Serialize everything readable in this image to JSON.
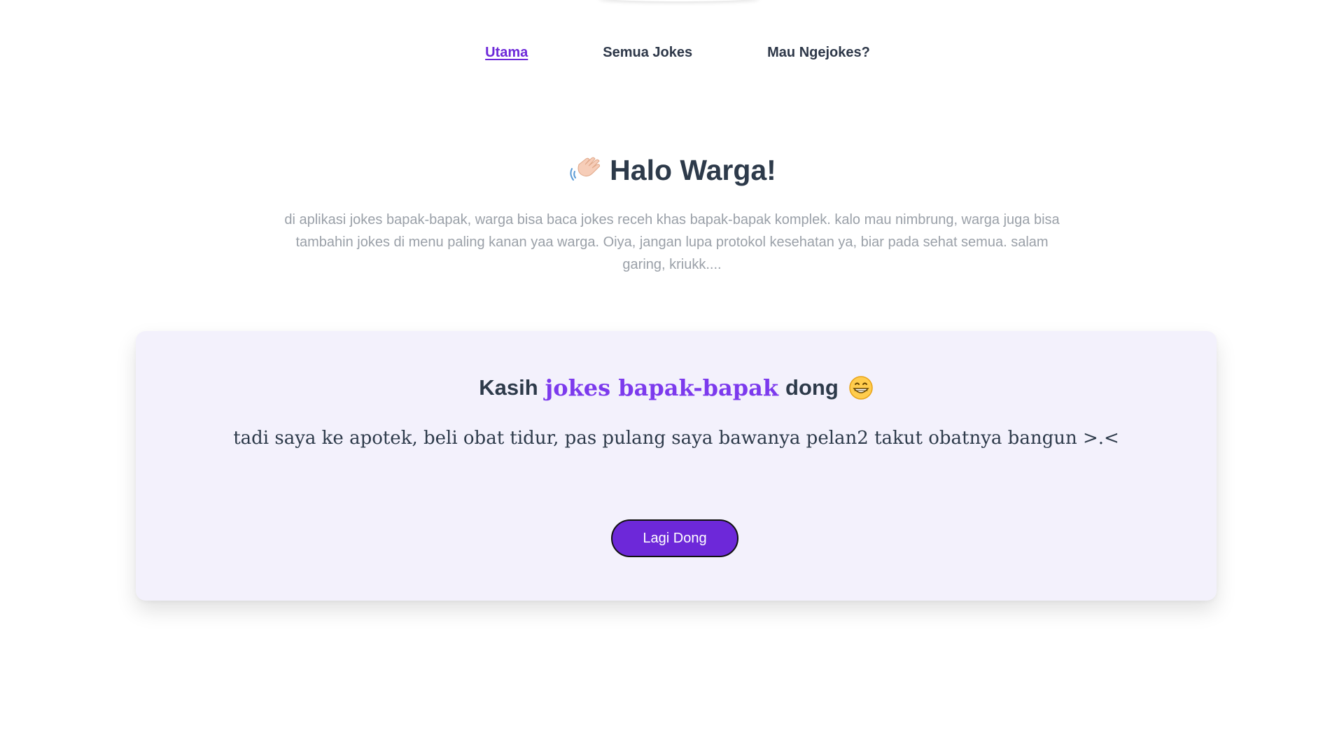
{
  "nav": {
    "items": [
      {
        "label": "Utama",
        "active": true
      },
      {
        "label": "Semua Jokes",
        "active": false
      },
      {
        "label": "Mau Ngejokes?",
        "active": false
      }
    ]
  },
  "hero": {
    "icon": "waving-hand-icon",
    "title": "Halo Warga!",
    "description": "di aplikasi jokes bapak-bapak, warga bisa baca jokes receh khas bapak-bapak komplek. kalo mau nimbrung, warga juga bisa tambahin jokes di menu paling kanan yaa warga. Oiya, jangan lupa protokol kesehatan ya, biar pada sehat semua. salam garing, kriukk...."
  },
  "card": {
    "title_prefix": "Kasih",
    "title_highlight": "jokes bapak-bapak",
    "title_suffix": "dong",
    "title_icon": "grinning-face-icon",
    "joke": "tadi saya ke apotek, beli obat tidur, pas pulang saya bawanya pelan2 takut obatnya bangun >.<",
    "button_label": "Lagi Dong"
  },
  "colors": {
    "accent": "#6d28d9",
    "highlight": "#7c3aed",
    "card_background": "#f3f1fc",
    "heading": "#2d3a4a",
    "muted_text": "#9aa0a8"
  }
}
